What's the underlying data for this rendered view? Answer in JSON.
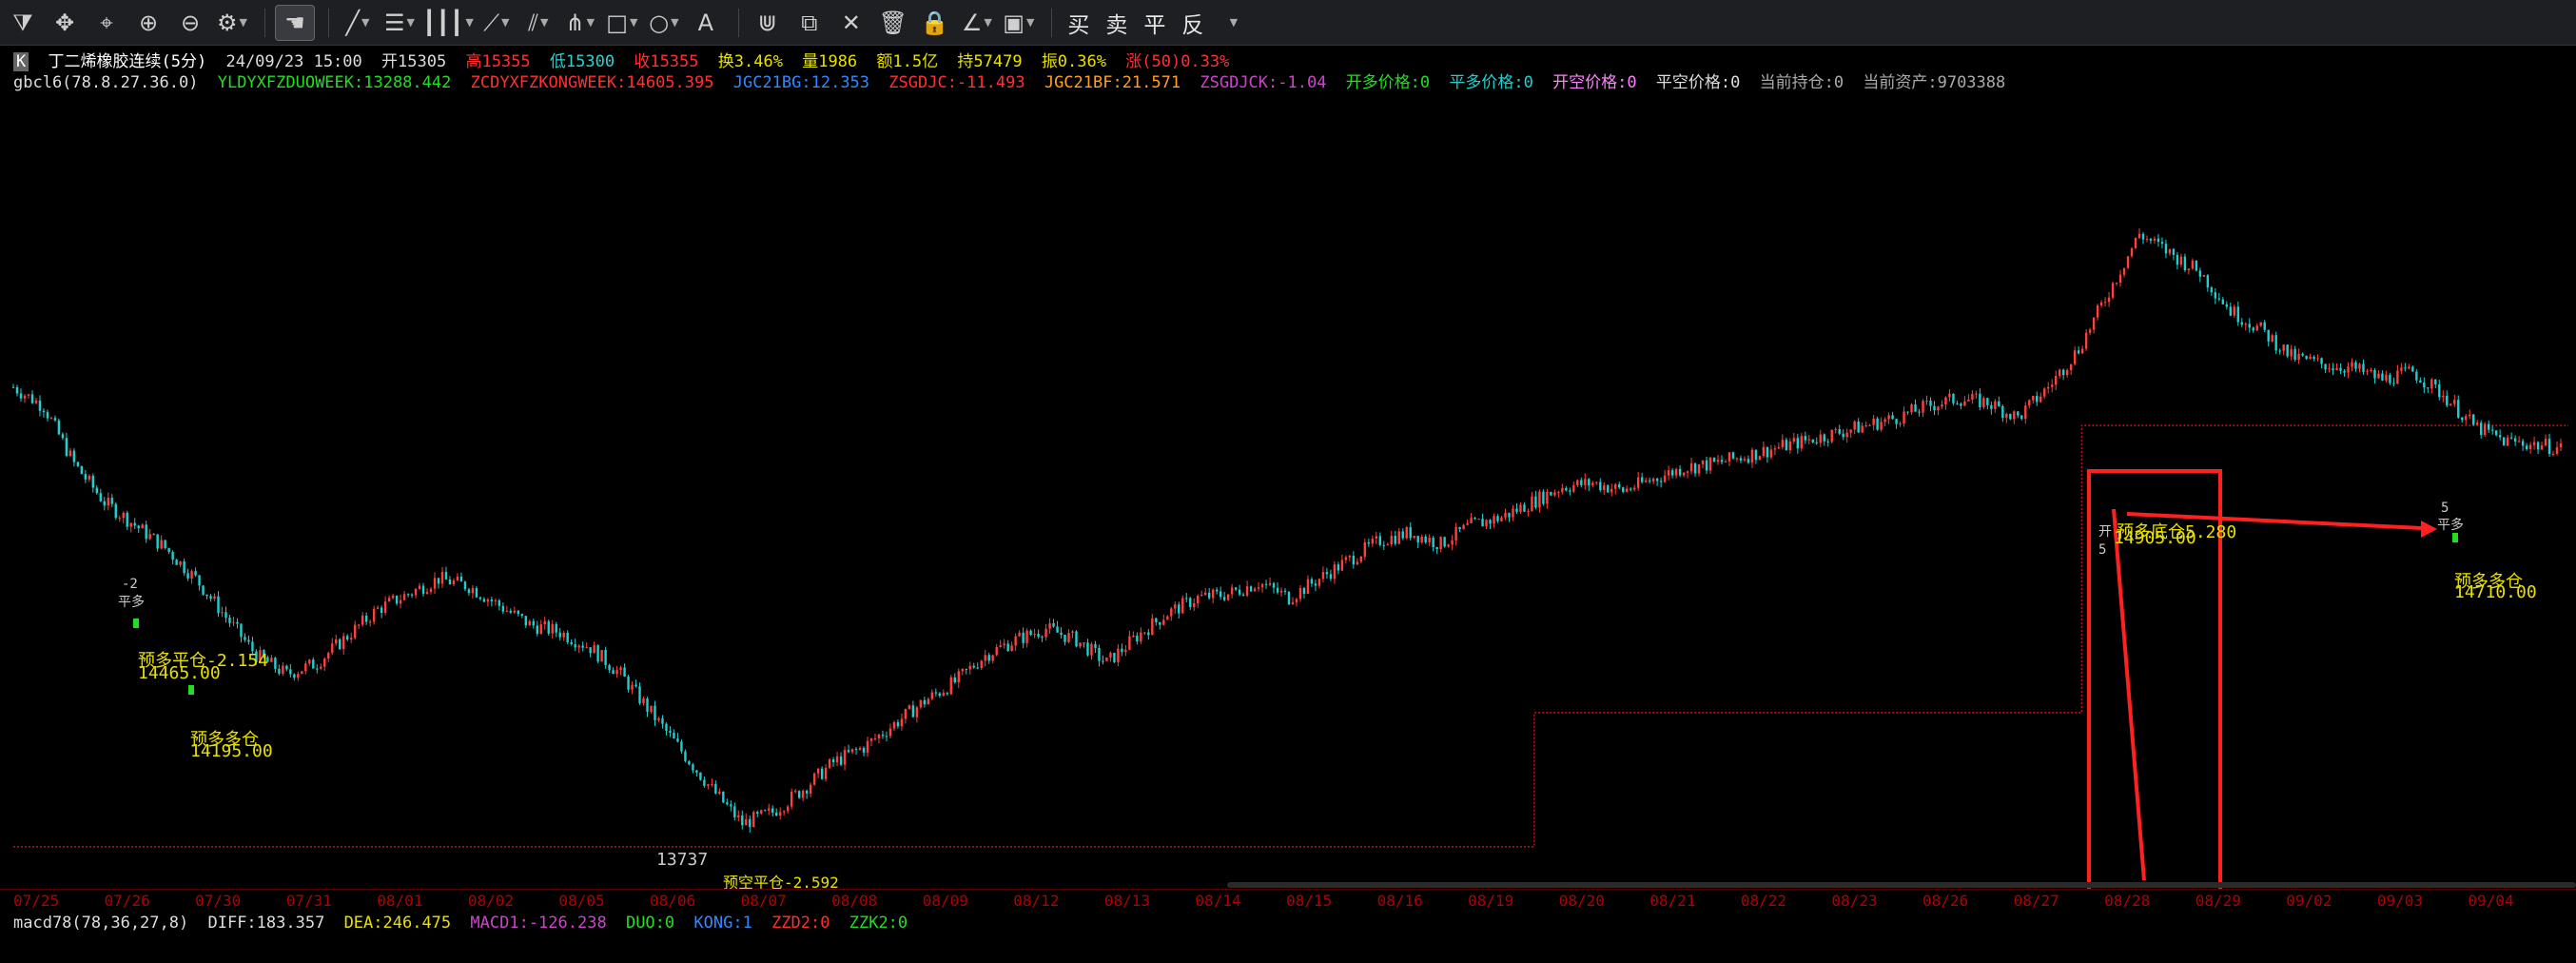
{
  "toolbar": {
    "icons": [
      "filter-icon",
      "move-icon",
      "crosshair-icon",
      "zoom-in-icon",
      "zoom-out-icon",
      "settings-icon",
      "hand-cursor-icon",
      "line-tool-icon",
      "text-tool-icon",
      "grid-tool-icon",
      "fan-tool-icon",
      "channel-tool-icon",
      "pitchfork-tool-icon",
      "rectangle-tool-icon",
      "circle-tool-icon",
      "text-A-icon",
      "magnet-icon",
      "copy-icon",
      "delete-icon",
      "trash-icon",
      "lock-icon",
      "draw-angle-icon",
      "save-icon"
    ],
    "trade_buttons": [
      "买",
      "卖",
      "平",
      "反"
    ]
  },
  "info": {
    "title": "丁二烯橡胶连续(5分)",
    "datetime": "24/09/23 15:00",
    "open": "开15305",
    "high": "高15355",
    "low": "低15300",
    "close": "收15355",
    "turnover_rate": "换3.46%",
    "volume": "量1986",
    "amount": "额1.5亿",
    "position": "持57479",
    "amplitude": "振0.36%",
    "change": "涨(50)0.33%",
    "indicator": "gbcl6(78.8.27.36.0)",
    "ylydx": "YLDYXFZDUOWEEK:13288.442",
    "zcdy": "ZCDYXFZKONGWEEK:14605.395",
    "jgc21bg": "JGC21BG:12.353",
    "zsgdjc": "ZSGDJC:-11.493",
    "jgc21bf": "JGC21BF:21.571",
    "zsgdjck": "ZSGDJCK:-1.04",
    "kaiduo": "开多价格:0",
    "pingduo": "平多价格:0",
    "kaikong": "开空价格:0",
    "pingkong": "平空价格:0",
    "holding": "当前持仓:0",
    "assets": "当前资产:9703388"
  },
  "chart_labels": {
    "low_value": "13737",
    "label_a": "平多",
    "label_a_num": "-2",
    "label_b": "预多平仓-2.154",
    "label_b_price": "14465.00",
    "label_c": "预多多仓",
    "label_c_price": "14195.00",
    "label_d": "预多底仓5.280",
    "label_d_price": "14905.00",
    "label_d_pre": "开",
    "label_d_num": "5",
    "label_e": "预多多仓",
    "label_e_price": "14710.00",
    "label_e_top": "平多",
    "label_e_num": "5",
    "bottom_label": "预空平仓-2.592"
  },
  "dates": [
    "07/25",
    "07/26",
    "07/30",
    "07/31",
    "08/01",
    "08/02",
    "08/05",
    "08/06",
    "08/07",
    "08/08",
    "08/09",
    "08/12",
    "08/13",
    "08/14",
    "08/15",
    "08/16",
    "08/19",
    "08/20",
    "08/21",
    "08/22",
    "08/23",
    "08/26",
    "08/27",
    "08/28",
    "08/29",
    "09/02",
    "09/03",
    "09/04"
  ],
  "macd": {
    "name": "macd78(78,36,27,8)",
    "diff": "DIFF:183.357",
    "dea": "DEA:246.475",
    "macd1": "MACD1:-126.238",
    "duo": "DUO:0",
    "kong": "KONG:1",
    "zzd2": "ZZD2:0",
    "zzk2": "ZZK2:0"
  },
  "colors": {
    "up": "#ff4040",
    "down": "#20d0d0",
    "highlight": "#ff2020",
    "label_yellow": "#e8e000",
    "green_marker": "#22dd22"
  },
  "chart_data": {
    "type": "line",
    "series": [
      {
        "values": [
          14900,
          14850,
          14700,
          14600,
          14540,
          14480,
          14400,
          14300,
          14200,
          14150,
          14180,
          14250,
          14320,
          14360,
          14400,
          14380,
          14330,
          14280,
          14260,
          14220,
          14150,
          14050,
          13950,
          13850,
          13760,
          13790,
          13850,
          13920,
          13960,
          14020,
          14080,
          14130,
          14200,
          14240,
          14270,
          14240,
          14180,
          14250,
          14310,
          14350,
          14360,
          14390,
          14350,
          14400,
          14450,
          14500,
          14520,
          14490,
          14540,
          14560,
          14600,
          14640,
          14650,
          14630,
          14660,
          14690,
          14700,
          14720,
          14740,
          14760,
          14780,
          14800,
          14820,
          14850,
          14870,
          14860,
          14820,
          14900,
          15000,
          15150,
          15300,
          15250,
          15200,
          15100,
          15050,
          14980,
          14960,
          14950,
          14920,
          14940,
          14880,
          14800,
          14760,
          14750,
          14740
        ]
      }
    ],
    "step_level": [
      13700,
      13700,
      13700,
      13700,
      13700,
      13700,
      13700,
      13700,
      13700,
      13700,
      13700,
      13700,
      13700,
      13700,
      13700,
      13700,
      13700,
      13700,
      13700,
      13700,
      13700,
      13700,
      13700,
      13700,
      13700,
      13700,
      13700,
      13700,
      13700,
      13700,
      13700,
      13700,
      13700,
      13700,
      13700,
      13700,
      13700,
      13700,
      13700,
      13700,
      13700,
      13700,
      13700,
      13700,
      13700,
      13700,
      13700,
      13700,
      13700,
      13700,
      14050,
      14050,
      14050,
      14050,
      14050,
      14050,
      14050,
      14050,
      14050,
      14050,
      14050,
      14050,
      14050,
      14050,
      14050,
      14050,
      14050,
      14050,
      14800,
      14800,
      14800,
      14800,
      14800,
      14800,
      14800,
      14800,
      14800,
      14800,
      14800,
      14800,
      14800,
      14800,
      14800,
      14800,
      14800
    ],
    "ylim": [
      13600,
      15650
    ]
  }
}
